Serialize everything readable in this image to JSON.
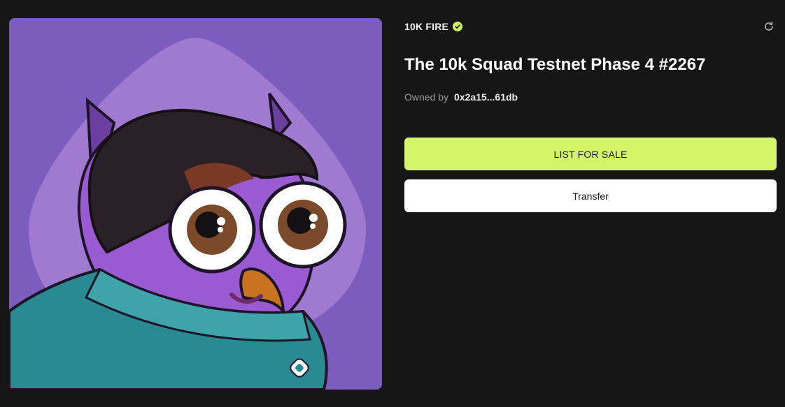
{
  "nft": {
    "collection_name": "10K FIRE",
    "title": "The 10k Squad Testnet Phase 4 #2267",
    "owned_by_label": "Owned by",
    "owner_address": "0x2a15...61db"
  },
  "actions": {
    "list_for_sale": "LIST FOR SALE",
    "transfer": "Transfer"
  },
  "icons": {
    "verified": "check-circle-icon",
    "refresh": "refresh-icon"
  },
  "colors": {
    "background": "#161616",
    "accent": "#d4f56a",
    "verified": "#cdf264",
    "art_background": "#7c5dbd"
  }
}
